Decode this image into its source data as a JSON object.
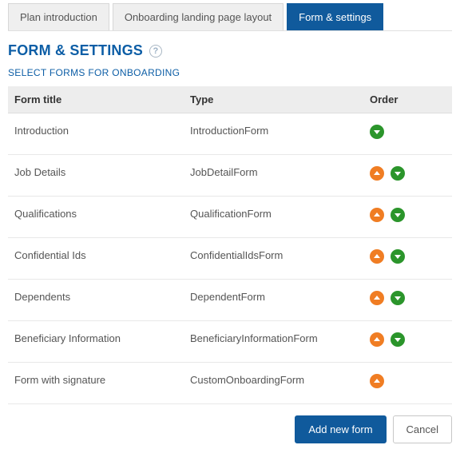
{
  "tabs": [
    {
      "label": "Plan introduction",
      "active": false
    },
    {
      "label": "Onboarding landing page layout",
      "active": false
    },
    {
      "label": "Form & settings",
      "active": true
    }
  ],
  "page_title": "FORM & SETTINGS",
  "subhead": "SELECT FORMS FOR ONBOARDING",
  "columns": {
    "title": "Form title",
    "type": "Type",
    "order": "Order"
  },
  "rows": [
    {
      "title": "Introduction",
      "type": "IntroductionForm",
      "up": false,
      "down": true
    },
    {
      "title": "Job Details",
      "type": "JobDetailForm",
      "up": true,
      "down": true
    },
    {
      "title": "Qualifications",
      "type": "QualificationForm",
      "up": true,
      "down": true
    },
    {
      "title": "Confidential Ids",
      "type": "ConfidentialIdsForm",
      "up": true,
      "down": true
    },
    {
      "title": "Dependents",
      "type": "DependentForm",
      "up": true,
      "down": true
    },
    {
      "title": "Beneficiary Information",
      "type": "BeneficiaryInformationForm",
      "up": true,
      "down": true
    },
    {
      "title": "Form with signature",
      "type": "CustomOnboardingForm",
      "up": true,
      "down": false
    }
  ],
  "buttons": {
    "add": "Add new form",
    "cancel": "Cancel"
  }
}
